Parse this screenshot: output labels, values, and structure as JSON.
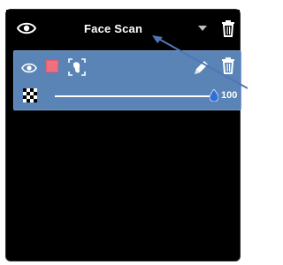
{
  "header": {
    "title": "Face Scan",
    "eye_icon": "eye-icon",
    "dropdown_icon": "caret-down-icon",
    "trash_icon": "trash-icon"
  },
  "layer": {
    "visibility_icon": "eye-icon",
    "color_swatch": "#f07080",
    "face_icon": "face-scan-icon",
    "edit_icon": "pencil-icon",
    "trash_icon": "trash-icon",
    "opacity": {
      "icon": "checkerboard-opacity-icon",
      "value": "100",
      "fraction": 1.0
    }
  },
  "colors": {
    "panel_bg": "#000000",
    "layer_bg": "#5a83b6",
    "accent": "#2f6fd6"
  }
}
